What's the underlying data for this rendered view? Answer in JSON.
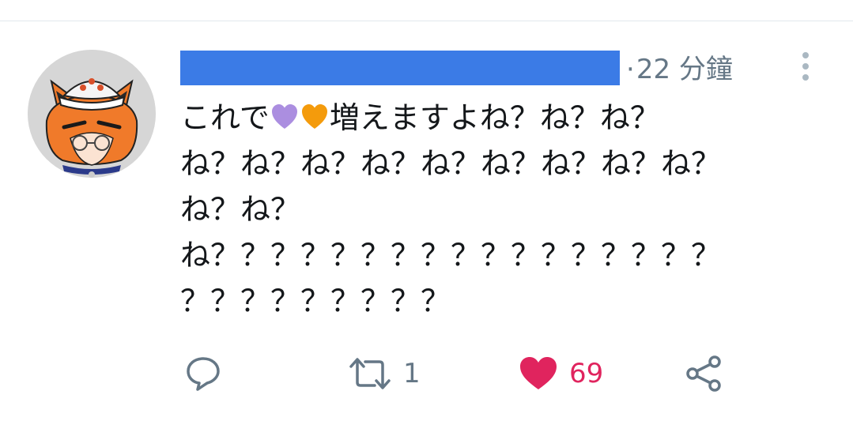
{
  "tweet": {
    "author_name_redacted": true,
    "timestamp_separator": "·",
    "timestamp": "22 分鐘",
    "text_lines": [
      {
        "before": "これで",
        "emojis": [
          "purple-heart",
          "orange-heart"
        ],
        "after": "増えますよね？ね？ね？"
      },
      {
        "text": "ね？ね？ね？ね？ね？ね？ね？ね？ね？"
      },
      {
        "text": "ね？ね？"
      },
      {
        "text": "ね？？？？？？？？？？？？？？？？？"
      },
      {
        "text": "？？？？？？？？？"
      }
    ]
  },
  "actions": {
    "reply": {
      "icon": "reply-icon",
      "count": ""
    },
    "retweet": {
      "icon": "retweet-icon",
      "count": "1"
    },
    "like": {
      "icon": "heart-icon",
      "count": "69",
      "liked": true
    },
    "share": {
      "icon": "share-icon",
      "count": ""
    }
  },
  "colors": {
    "redaction": "#3b7be6",
    "muted": "#657786",
    "like": "#e0245e",
    "purple_heart": "#ab8ee0",
    "orange_heart": "#f49b0c"
  }
}
